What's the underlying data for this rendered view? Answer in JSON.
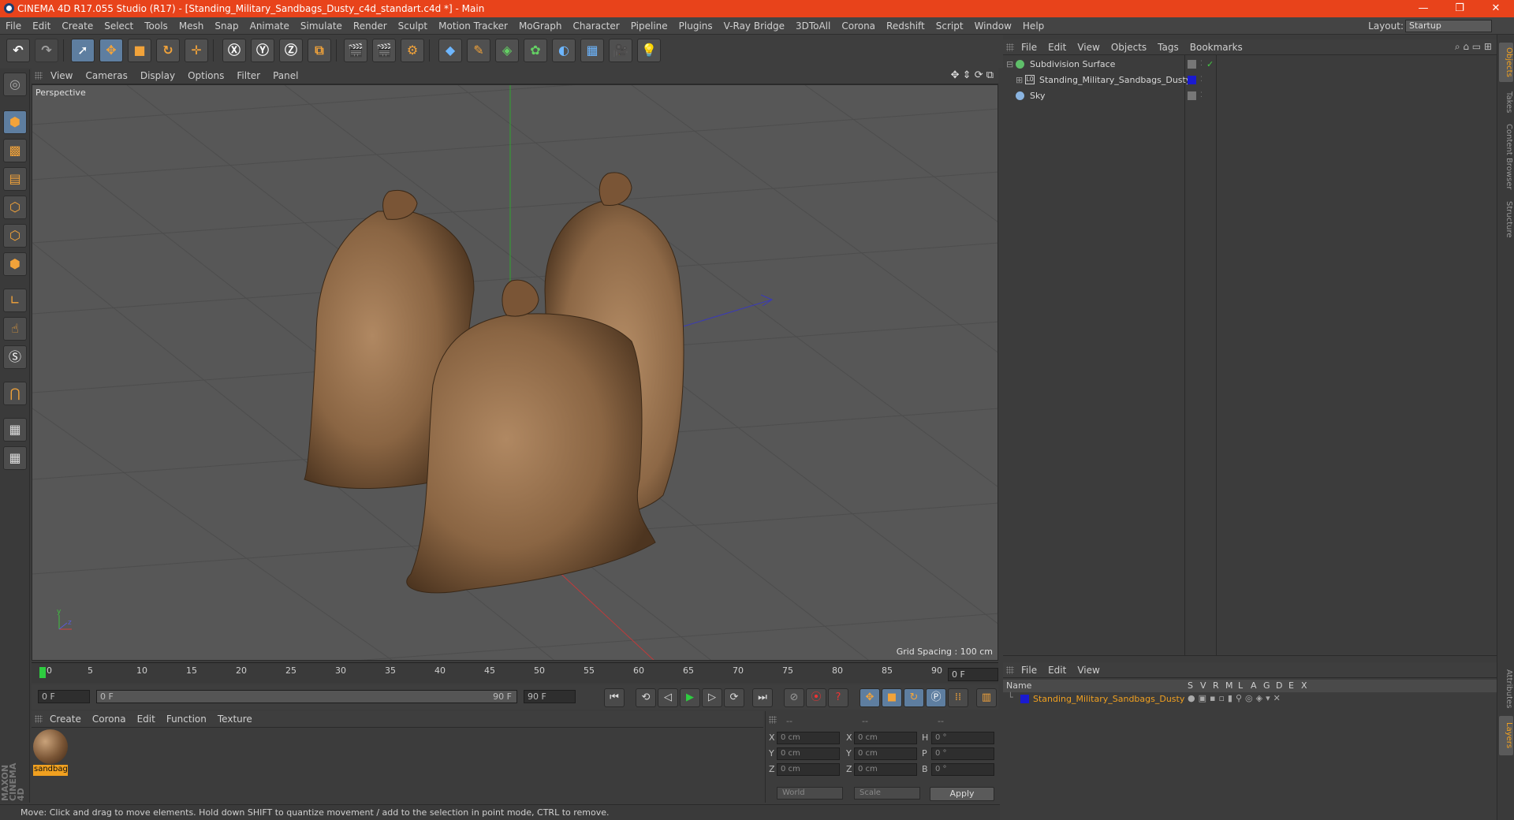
{
  "window": {
    "title": "CINEMA 4D R17.055 Studio (R17) - [Standing_Military_Sandbags_Dusty_c4d_standart.c4d *] - Main",
    "minimize": "—",
    "maximize": "❐",
    "close": "✕"
  },
  "menu": [
    "File",
    "Edit",
    "Create",
    "Select",
    "Tools",
    "Mesh",
    "Snap",
    "Animate",
    "Simulate",
    "Render",
    "Sculpt",
    "Motion Tracker",
    "MoGraph",
    "Character",
    "Pipeline",
    "Plugins",
    "V-Ray Bridge",
    "3DToAll",
    "Corona",
    "Redshift",
    "Script",
    "Window",
    "Help"
  ],
  "layout": {
    "label": "Layout:",
    "value": "Startup"
  },
  "viewport": {
    "menu": [
      "View",
      "Cameras",
      "Display",
      "Options",
      "Filter",
      "Panel"
    ],
    "label": "Perspective",
    "grid_spacing": "Grid Spacing : 100 cm"
  },
  "timeline": {
    "ticks": [
      "0",
      "5",
      "10",
      "15",
      "20",
      "25",
      "30",
      "35",
      "40",
      "45",
      "50",
      "55",
      "60",
      "65",
      "70",
      "75",
      "80",
      "85",
      "90"
    ],
    "current_frame": "0 F",
    "start_field": "0 F",
    "range_start": "0 F",
    "range_end": "90 F",
    "end_field": "90 F"
  },
  "material_manager": {
    "menu": [
      "Create",
      "Corona",
      "Edit",
      "Function",
      "Texture"
    ],
    "material_name": "sandbag"
  },
  "coordinates": {
    "headers": [
      "--",
      "--",
      "--"
    ],
    "rows": [
      {
        "axis": "X",
        "pos": "0 cm",
        "axis2": "X",
        "size": "0 cm",
        "rot_axis": "H",
        "rot": "0 °"
      },
      {
        "axis": "Y",
        "pos": "0 cm",
        "axis2": "Y",
        "size": "0 cm",
        "rot_axis": "P",
        "rot": "0 °"
      },
      {
        "axis": "Z",
        "pos": "0 cm",
        "axis2": "Z",
        "size": "0 cm",
        "rot_axis": "B",
        "rot": "0 °"
      }
    ],
    "space": "World",
    "mode": "Scale",
    "apply": "Apply"
  },
  "status": "Move: Click and drag to move elements. Hold down SHIFT to quantize movement / add to the selection in point mode, CTRL to remove.",
  "maxon_logo": "MAXON CINEMA 4D",
  "object_manager": {
    "menu": [
      "File",
      "Edit",
      "View",
      "Objects",
      "Tags",
      "Bookmarks"
    ],
    "objects": [
      {
        "name": "Subdivision Surface",
        "icon": "subdivision-icon",
        "color": "#5fbf6a"
      },
      {
        "name": "Standing_Military_Sandbags_Dusty",
        "icon": "polygon-object-icon",
        "color": "#1a1ad0"
      },
      {
        "name": "Sky",
        "icon": "sky-icon",
        "color": "#8ab4e0"
      }
    ]
  },
  "layer_manager": {
    "menu": [
      "File",
      "Edit",
      "View"
    ],
    "columns": [
      "Name",
      "S",
      "V",
      "R",
      "M",
      "L",
      "A",
      "G",
      "D",
      "E",
      "X"
    ],
    "layers": [
      {
        "name": "Standing_Military_Sandbags_Dusty",
        "color": "#1a1ad0"
      }
    ]
  },
  "right_tabs": [
    "Objects",
    "Takes",
    "Content Browser",
    "Structure",
    "Attributes",
    "Layers"
  ],
  "colors": {
    "title_bar": "#e8431b",
    "accent": "#f0a020",
    "selection": "#5e7ea0"
  }
}
